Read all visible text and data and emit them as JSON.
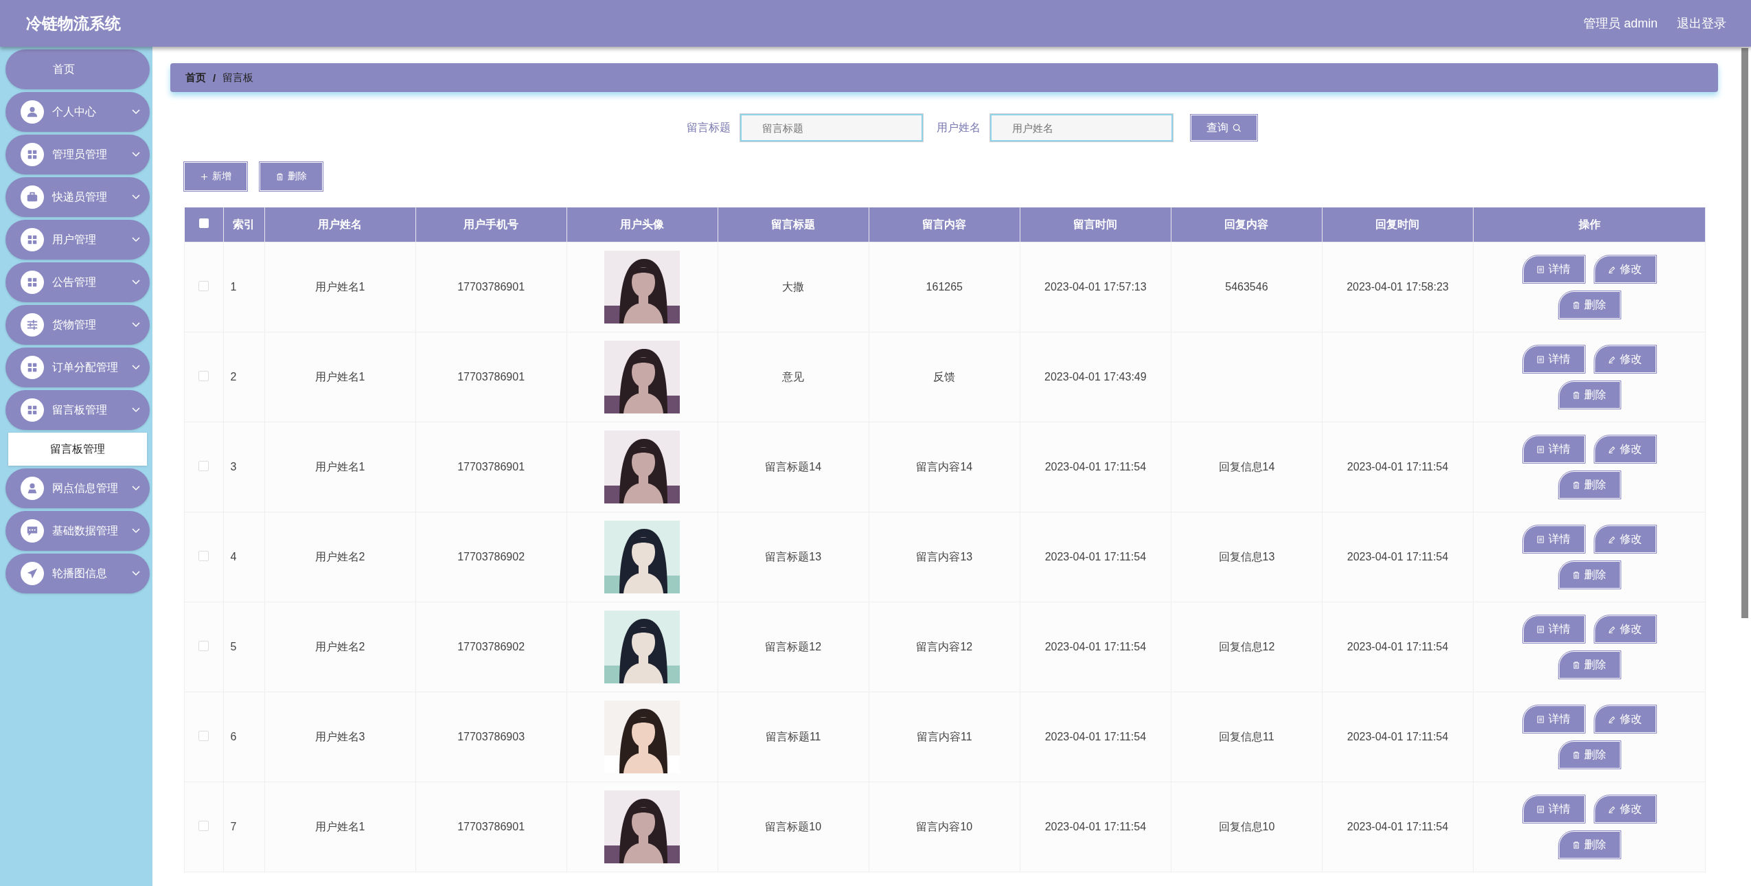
{
  "header": {
    "title": "冷链物流系统",
    "user": "管理员 admin",
    "logout": "退出登录"
  },
  "sidebar": {
    "items": [
      {
        "label": "首页",
        "kind": "home"
      },
      {
        "label": "个人中心",
        "kind": "group"
      },
      {
        "label": "管理员管理",
        "kind": "group"
      },
      {
        "label": "快递员管理",
        "kind": "group"
      },
      {
        "label": "用户管理",
        "kind": "group"
      },
      {
        "label": "公告管理",
        "kind": "group"
      },
      {
        "label": "货物管理",
        "kind": "group"
      },
      {
        "label": "订单分配管理",
        "kind": "group"
      },
      {
        "label": "留言板管理",
        "kind": "group",
        "children": [
          {
            "label": "留言板管理",
            "selected": true
          }
        ]
      },
      {
        "label": "网点信息管理",
        "kind": "group"
      },
      {
        "label": "基础数据管理",
        "kind": "group"
      },
      {
        "label": "轮播图信息",
        "kind": "group"
      }
    ]
  },
  "breadcrumb": {
    "items": [
      "首页",
      "留言板"
    ],
    "separator": "/"
  },
  "search": {
    "fields": [
      {
        "label": "留言标题",
        "placeholder": "留言标题"
      },
      {
        "label": "用户姓名",
        "placeholder": "用户姓名"
      }
    ],
    "button": "查询"
  },
  "toolbar": [
    {
      "label": "新增",
      "kind": "add"
    },
    {
      "label": "删除",
      "kind": "delete"
    }
  ],
  "table": {
    "select_all_checked": false,
    "columns": [
      "索引",
      "用户姓名",
      "用户手机号",
      "用户头像",
      "留言标题",
      "留言内容",
      "留言时间",
      "回复内容",
      "回复时间",
      "操作"
    ],
    "rows": [
      {
        "checked": false,
        "index": "1",
        "name": "用户姓名1",
        "phone": "17703786901",
        "title": "大撒",
        "content": "161265",
        "time": "2023-04-01 17:57:13",
        "reply": "5463546",
        "reply_time": "2023-04-01 17:58:23",
        "actions": [
          "详情",
          "修改",
          "删除"
        ]
      },
      {
        "checked": false,
        "index": "2",
        "name": "用户姓名1",
        "phone": "17703786901",
        "title": "意见",
        "content": "反馈",
        "time": "2023-04-01 17:43:49",
        "actions": [
          "详情",
          "修改",
          "删除"
        ]
      },
      {
        "checked": false,
        "index": "3",
        "name": "用户姓名1",
        "phone": "17703786901",
        "title": "留言标题14",
        "content": "留言内容14",
        "time": "2023-04-01 17:11:54",
        "reply": "回复信息14",
        "reply_time": "2023-04-01 17:11:54",
        "actions": [
          "详情",
          "修改",
          "删除"
        ]
      },
      {
        "checked": false,
        "index": "4",
        "name": "用户姓名2",
        "phone": "17703786902",
        "title": "留言标题13",
        "content": "留言内容13",
        "time": "2023-04-01 17:11:54",
        "reply": "回复信息13",
        "reply_time": "2023-04-01 17:11:54",
        "actions": [
          "详情",
          "修改",
          "删除"
        ]
      },
      {
        "checked": false,
        "index": "5",
        "name": "用户姓名2",
        "phone": "17703786902",
        "title": "留言标题12",
        "content": "留言内容12",
        "time": "2023-04-01 17:11:54",
        "reply": "回复信息12",
        "reply_time": "2023-04-01 17:11:54",
        "actions": [
          "详情",
          "修改",
          "删除"
        ]
      },
      {
        "checked": false,
        "index": "6",
        "name": "用户姓名3",
        "phone": "17703786903",
        "title": "留言标题11",
        "content": "留言内容11",
        "time": "2023-04-01 17:11:54",
        "reply": "回复信息11",
        "reply_time": "2023-04-01 17:11:54",
        "actions": [
          "详情",
          "修改",
          "删除"
        ]
      },
      {
        "checked": false,
        "index": "7",
        "name": "用户姓名1",
        "phone": "17703786901",
        "title": "留言标题10",
        "content": "留言内容10",
        "time": "2023-04-01 17:11:54",
        "reply": "回复信息10",
        "reply_time": "2023-04-01 17:11:54",
        "actions": [
          "详情",
          "修改",
          "删除"
        ]
      }
    ]
  }
}
